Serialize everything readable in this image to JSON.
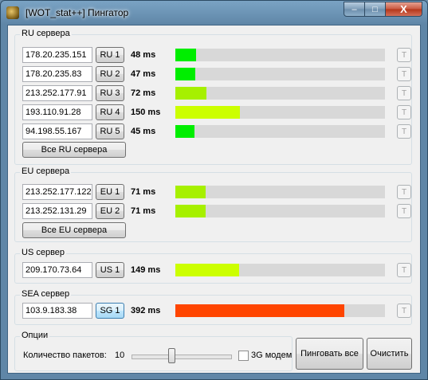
{
  "window": {
    "title": "[WOT_stat++] Пингатор",
    "min_label": "–",
    "max_label": "□",
    "close_label": "X"
  },
  "groups": {
    "ru": {
      "title": "RU сервера",
      "all_label": "Все RU сервера",
      "rows": [
        {
          "ip": "178.20.235.151",
          "server": "RU 1",
          "ms": "48 ms",
          "ping": 48,
          "color": "#00ee00",
          "t": "T"
        },
        {
          "ip": "178.20.235.83",
          "server": "RU 2",
          "ms": "47 ms",
          "ping": 47,
          "color": "#00ee00",
          "t": "T"
        },
        {
          "ip": "213.252.177.91",
          "server": "RU 3",
          "ms": "72 ms",
          "ping": 72,
          "color": "#a6f000",
          "t": "T"
        },
        {
          "ip": "193.110.91.28",
          "server": "RU 4",
          "ms": "150 ms",
          "ping": 150,
          "color": "#ccff00",
          "t": "T"
        },
        {
          "ip": "94.198.55.167",
          "server": "RU 5",
          "ms": "45 ms",
          "ping": 45,
          "color": "#00ee00",
          "t": "T"
        }
      ]
    },
    "eu": {
      "title": "EU сервера",
      "all_label": "Все EU сервера",
      "rows": [
        {
          "ip": "213.252.177.122",
          "server": "EU 1",
          "ms": "71 ms",
          "ping": 71,
          "color": "#a6f000",
          "t": "T"
        },
        {
          "ip": "213.252.131.29",
          "server": "EU 2",
          "ms": "71 ms",
          "ping": 71,
          "color": "#a6f000",
          "t": "T"
        }
      ]
    },
    "us": {
      "title": "US сервер",
      "rows": [
        {
          "ip": "209.170.73.64",
          "server": "US 1",
          "ms": "149 ms",
          "ping": 149,
          "color": "#ccff00",
          "t": "T"
        }
      ]
    },
    "sea": {
      "title": "SEA сервер",
      "rows": [
        {
          "ip": "103.9.183.38",
          "server": "SG 1",
          "ms": "392 ms",
          "ping": 392,
          "color": "#ff4500",
          "t": "T"
        }
      ]
    }
  },
  "options": {
    "title": "Опции",
    "packets_label": "Количество пакетов:",
    "packets_value": "10",
    "slider_level": 0.4,
    "modem_label": "3G модем",
    "modem_checked": false,
    "ping_all_label": "Пинговать все",
    "clear_label": "Очистить"
  },
  "ping_scale_max": 487
}
